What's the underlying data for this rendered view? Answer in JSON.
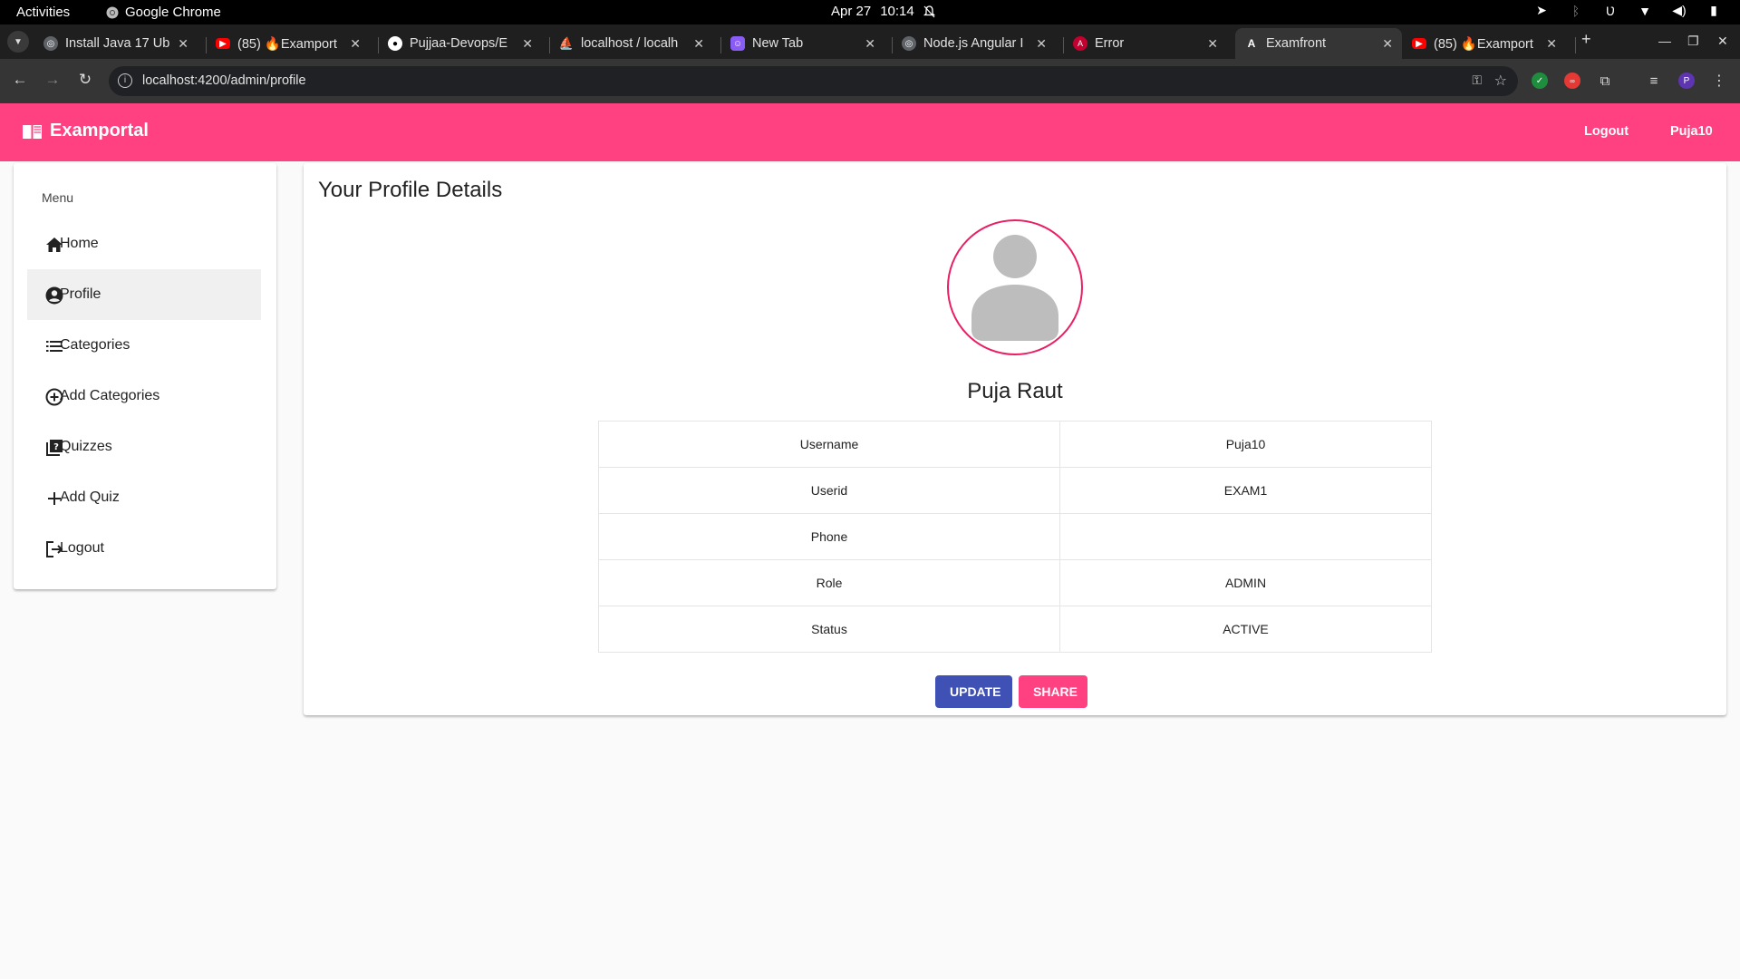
{
  "os": {
    "activities": "Activities",
    "app_name": "Google Chrome",
    "date": "Apr 27",
    "time": "10:14"
  },
  "tabs": [
    {
      "title": "Install Java 17 Ub",
      "favicon": "globe-icon",
      "color": "#5f6368"
    },
    {
      "title": "(85) 🔥Examport",
      "favicon": "youtube-icon",
      "color": "#ff0000"
    },
    {
      "title": "Pujjaa-Devops/E",
      "favicon": "github-icon",
      "color": "#ffffff"
    },
    {
      "title": "localhost / localh",
      "favicon": "phpmyadmin-icon",
      "color": "#f29111"
    },
    {
      "title": "New Tab",
      "favicon": "newtab-icon",
      "color": "#8a5cf6"
    },
    {
      "title": "Node.js Angular I",
      "favicon": "globe-icon",
      "color": "#5f6368"
    },
    {
      "title": "Error",
      "favicon": "angular-icon",
      "color": "#c3002f"
    },
    {
      "title": "Examfront",
      "favicon": "angular-icon",
      "color": "#ffffff",
      "active": true
    },
    {
      "title": "(85) 🔥Examport",
      "favicon": "youtube-icon",
      "color": "#ff0000"
    }
  ],
  "browser": {
    "url": "localhost:4200/admin/profile",
    "profile_initial": "P"
  },
  "app": {
    "brand": "Examportal",
    "brand_color": "#ff4081",
    "nav_logout": "Logout",
    "nav_user": "Puja10"
  },
  "sidebar": {
    "title": "Menu",
    "items": [
      {
        "label": "Home",
        "icon": "home-icon"
      },
      {
        "label": "Profile",
        "icon": "account-circle-icon",
        "active": true
      },
      {
        "label": "Categories",
        "icon": "list-icon"
      },
      {
        "label": "Add Categories",
        "icon": "add-circle-icon"
      },
      {
        "label": "Quizzes",
        "icon": "quiz-icon"
      },
      {
        "label": "Add Quiz",
        "icon": "plus-icon"
      },
      {
        "label": "Logout",
        "icon": "logout-icon"
      }
    ]
  },
  "profile": {
    "heading": "Your Profile Details",
    "name": "Puja Raut",
    "rows": [
      {
        "label": "Username",
        "value": "Puja10"
      },
      {
        "label": "Userid",
        "value": "EXAM1"
      },
      {
        "label": "Phone",
        "value": ""
      },
      {
        "label": "Role",
        "value": "ADMIN"
      },
      {
        "label": "Status",
        "value": "ACTIVE"
      }
    ],
    "update_label": "UPDATE",
    "share_label": "SHARE",
    "update_color": "#3f51b5",
    "share_color": "#ff4081"
  }
}
